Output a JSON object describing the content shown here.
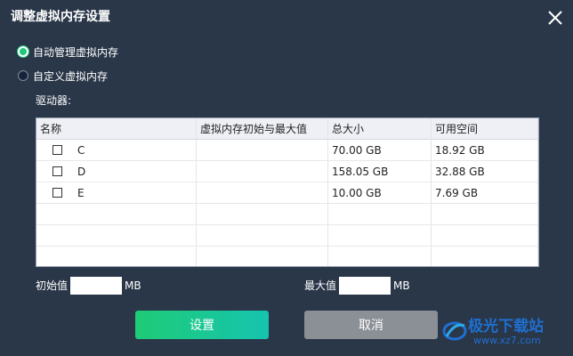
{
  "dialog": {
    "title": "调整虚拟内存设置"
  },
  "options": {
    "auto": "自动管理虚拟内存",
    "custom": "自定义虚拟内存",
    "selected": "auto"
  },
  "drives_label": "驱动器:",
  "table": {
    "headers": [
      "名称",
      "虚拟内存初始与最大值",
      "总大小",
      "可用空间"
    ],
    "rows": [
      {
        "name": "C",
        "range": "",
        "total": "70.00 GB",
        "free": "18.92 GB"
      },
      {
        "name": "D",
        "range": "",
        "total": "158.05 GB",
        "free": "32.88 GB"
      },
      {
        "name": "E",
        "range": "",
        "total": "10.00 GB",
        "free": "7.69 GB"
      }
    ]
  },
  "initial": {
    "label": "初始值",
    "value": "",
    "unit": "MB"
  },
  "maximum": {
    "label": "最大值",
    "value": "",
    "unit": "MB"
  },
  "buttons": {
    "ok": "设置",
    "cancel": "取消"
  },
  "watermark": {
    "line1": "极光下载站",
    "line2": "www.xz7.com"
  },
  "colors": {
    "accent": "#1ecb76",
    "background": "#2a3749",
    "cancel": "#8b8f96"
  }
}
